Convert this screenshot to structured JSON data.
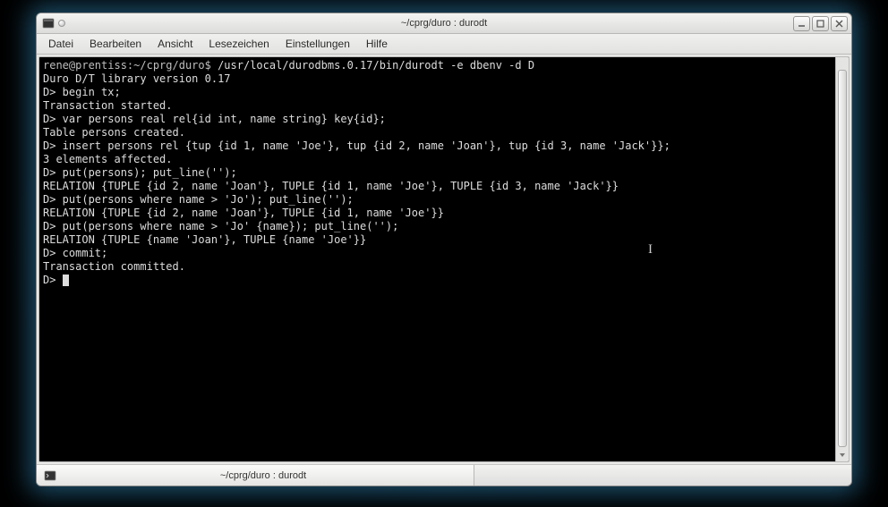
{
  "window": {
    "title": "~/cprg/duro : durodt"
  },
  "menubar": {
    "items": [
      "Datei",
      "Bearbeiten",
      "Ansicht",
      "Lesezeichen",
      "Einstellungen",
      "Hilfe"
    ]
  },
  "terminal": {
    "prompt_user": "rene@prentiss:~/cprg/duro$",
    "prompt_cmd": "/usr/local/durodbms.0.17/bin/durodt -e dbenv -d D",
    "lines": [
      "Duro D/T library version 0.17",
      "D> begin tx;",
      "Transaction started.",
      "D> var persons real rel{id int, name string} key{id};",
      "Table persons created.",
      "D> insert persons rel {tup {id 1, name 'Joe'}, tup {id 2, name 'Joan'}, tup {id 3, name 'Jack'}};",
      "3 elements affected.",
      "D> put(persons); put_line('');",
      "RELATION {TUPLE {id 2, name 'Joan'}, TUPLE {id 1, name 'Joe'}, TUPLE {id 3, name 'Jack'}}",
      "D> put(persons where name > 'Jo'); put_line('');",
      "RELATION {TUPLE {id 2, name 'Joan'}, TUPLE {id 1, name 'Joe'}}",
      "D> put(persons where name > 'Jo' {name}); put_line('');",
      "RELATION {TUPLE {name 'Joan'}, TUPLE {name 'Joe'}}",
      "D> commit;",
      "Transaction committed.",
      "D> "
    ]
  },
  "taskbar": {
    "tab_label": "~/cprg/duro : durodt"
  },
  "icons": {
    "terminal": "🖵",
    "pin": "•",
    "minimize": "—",
    "maximize": "▢",
    "close": "✕",
    "down": "▾"
  }
}
